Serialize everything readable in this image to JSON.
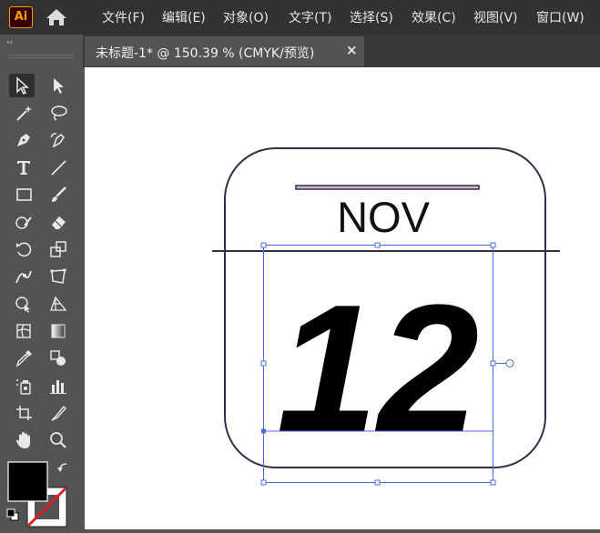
{
  "app": {
    "logo_text": "Ai",
    "accent": "#ff9a00"
  },
  "menu": [
    "文件(F)",
    "编辑(E)",
    "对象(O)",
    "文字(T)",
    "选择(S)",
    "效果(C)",
    "视图(V)",
    "窗口(W)"
  ],
  "toolbar_collapse": "‹‹",
  "tab": {
    "title": "未标题-1* @ 150.39 % (CMYK/预览)",
    "close": "×"
  },
  "artwork": {
    "month": "NOV",
    "day": "12",
    "stroke_color": "#3b2a4a",
    "selection_color": "#4a6bd6"
  },
  "tools": [
    "selection-tool",
    "direct-selection-tool",
    "magic-wand-tool",
    "lasso-tool",
    "pen-tool",
    "curvature-tool",
    "type-tool",
    "line-segment-tool",
    "rectangle-tool",
    "paintbrush-tool",
    "shaper-tool",
    "eraser-tool",
    "rotate-tool",
    "scale-tool",
    "puppet-warp-tool",
    "free-transform-tool",
    "shape-builder-tool",
    "perspective-grid-tool",
    "mesh-tool",
    "gradient-tool",
    "eyedropper-tool",
    "blend-tool",
    "symbol-sprayer-tool",
    "column-graph-tool",
    "artboard-tool",
    "slice-tool",
    "hand-tool",
    "zoom-tool"
  ],
  "colors": {
    "fill": "#000000",
    "stroke": "none"
  }
}
